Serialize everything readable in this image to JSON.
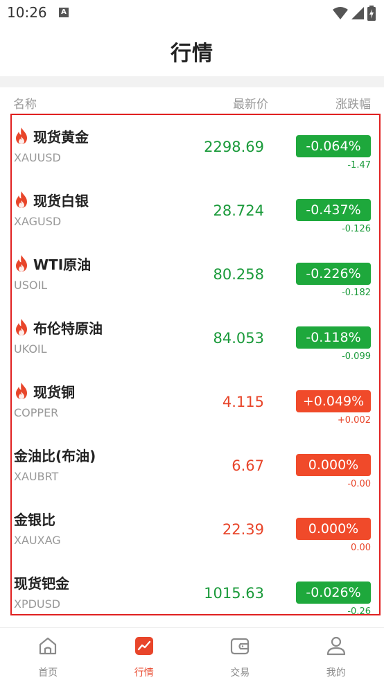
{
  "status_bar": {
    "time": "10:26",
    "notification_letter": "A"
  },
  "header": {
    "title": "行情"
  },
  "columns": {
    "name": "名称",
    "price": "最新价",
    "change": "涨跌幅"
  },
  "quotes": [
    {
      "name": "现货黄金",
      "code": "XAUUSD",
      "price": "2298.69",
      "change_pct": "-0.064%",
      "change": "-1.47",
      "hot": true,
      "trend": "down"
    },
    {
      "name": "现货白银",
      "code": "XAGUSD",
      "price": "28.724",
      "change_pct": "-0.437%",
      "change": "-0.126",
      "hot": true,
      "trend": "down"
    },
    {
      "name": "WTI原油",
      "code": "USOIL",
      "price": "80.258",
      "change_pct": "-0.226%",
      "change": "-0.182",
      "hot": true,
      "trend": "down"
    },
    {
      "name": "布伦特原油",
      "code": "UKOIL",
      "price": "84.053",
      "change_pct": "-0.118%",
      "change": "-0.099",
      "hot": true,
      "trend": "down"
    },
    {
      "name": "现货铜",
      "code": "COPPER",
      "price": "4.115",
      "change_pct": "+0.049%",
      "change": "+0.002",
      "hot": true,
      "trend": "up"
    },
    {
      "name": "金油比(布油)",
      "code": "XAUBRT",
      "price": "6.67",
      "change_pct": "0.000%",
      "change": "-0.00",
      "hot": false,
      "trend": "up"
    },
    {
      "name": "金银比",
      "code": "XAUXAG",
      "price": "22.39",
      "change_pct": "0.000%",
      "change": "0.00",
      "hot": false,
      "trend": "up"
    },
    {
      "name": "现货钯金",
      "code": "XPDUSD",
      "price": "1015.63",
      "change_pct": "-0.026%",
      "change": "-0.26",
      "hot": false,
      "trend": "down"
    }
  ],
  "tabs": [
    {
      "label": "首页",
      "icon": "home-icon",
      "active": false
    },
    {
      "label": "行情",
      "icon": "chart-icon",
      "active": true
    },
    {
      "label": "交易",
      "icon": "wallet-icon",
      "active": false
    },
    {
      "label": "我的",
      "icon": "user-icon",
      "active": false
    }
  ],
  "colors": {
    "up": "#f04a2a",
    "down": "#1ea83c",
    "hot": "#e8452a",
    "highlight_border": "#e02020"
  }
}
